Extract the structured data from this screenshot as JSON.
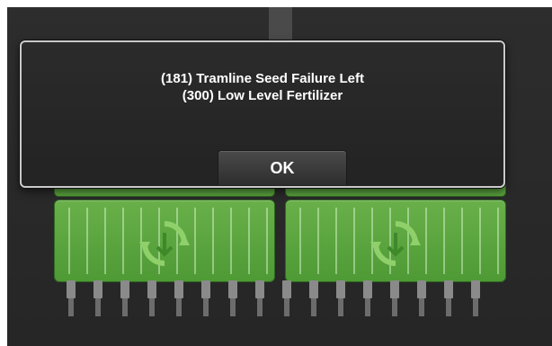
{
  "dialog": {
    "message_line1": "(181) Tramline Seed Failure Left",
    "message_line2": "(300) Low Level Fertilizer",
    "ok_label": "OK"
  },
  "icons": {
    "section_left": "rotate-arrows-icon",
    "section_right": "rotate-arrows-icon"
  },
  "colors": {
    "section_green": "#5aa23e",
    "background": "#2b2b2b",
    "dialog_border": "#c9c9c9"
  }
}
